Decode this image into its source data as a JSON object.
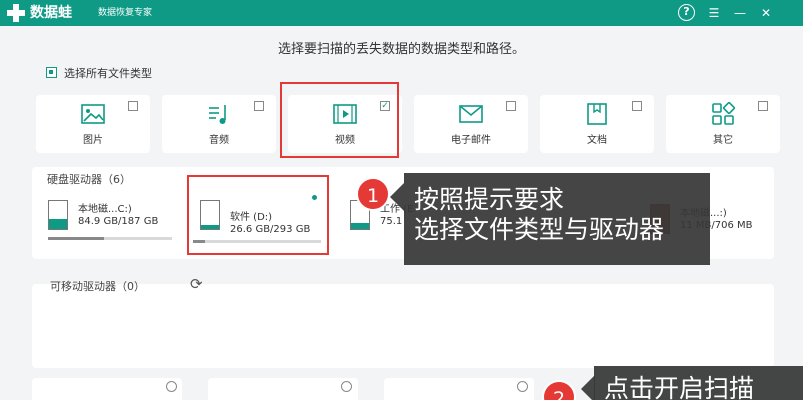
{
  "titlebar": {
    "app_name": "数据蛙",
    "subtitle": "数据恢复专家",
    "help": "?",
    "menu": "☰",
    "minimize": "—",
    "close": "✕",
    "color": "#0f9a86"
  },
  "heading": "选择要扫描的丢失数据的数据类型和路径。",
  "select_all_label": "选择所有文件类型",
  "file_types": [
    {
      "label": "图片",
      "icon": "image-icon",
      "checked": false
    },
    {
      "label": "音频",
      "icon": "music-icon",
      "checked": false
    },
    {
      "label": "视频",
      "icon": "video-icon",
      "checked": true,
      "check_mark": "✓"
    },
    {
      "label": "电子邮件",
      "icon": "email-icon",
      "checked": false
    },
    {
      "label": "文档",
      "icon": "document-icon",
      "checked": false
    },
    {
      "label": "其它",
      "icon": "other-icon",
      "checked": false
    }
  ],
  "hard_drives": {
    "title": "硬盘驱动器（6）",
    "items": [
      {
        "name": "本地磁...C:)",
        "size": "84.9 GB/187 GB",
        "usage": 0.45,
        "selected": false
      },
      {
        "name": "软件 (D:)",
        "size": "26.6 GB/293 GB",
        "usage": 0.09,
        "selected": true
      },
      {
        "name": "工作 (E",
        "size": "75.1",
        "selected": false
      },
      {
        "name": "本地磁...:)",
        "size": "11 MB/706 MB",
        "selected": false
      }
    ]
  },
  "removable": {
    "title": "可移动驱动器（0）",
    "refresh_icon": "⟳"
  },
  "callout1": {
    "number": "1",
    "line1": "按照提示要求",
    "line2": "选择文件类型与驱动器"
  },
  "callout2": {
    "number": "2",
    "line1": "点击开启扫描"
  },
  "colors": {
    "accent": "#0f9a86",
    "highlight": "#e53935"
  }
}
